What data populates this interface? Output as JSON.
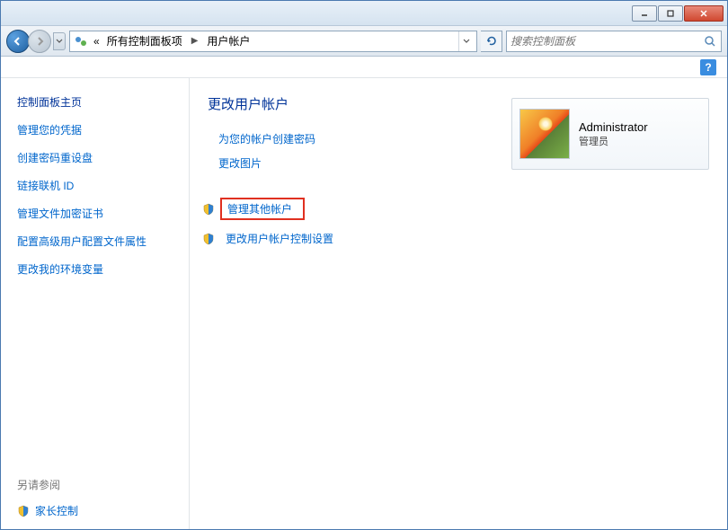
{
  "breadcrumb": {
    "prefix": "«",
    "seg1": "所有控制面板项",
    "seg2": "用户帐户"
  },
  "search": {
    "placeholder": "搜索控制面板"
  },
  "sidebar": {
    "title": "控制面板主页",
    "items": [
      "管理您的凭据",
      "创建密码重设盘",
      "链接联机 ID",
      "管理文件加密证书",
      "配置高级用户配置文件属性",
      "更改我的环境变量"
    ],
    "see_also": "另请参阅",
    "parental": "家长控制"
  },
  "main": {
    "title": "更改用户帐户",
    "links": {
      "create_password": "为您的帐户创建密码",
      "change_picture": "更改图片",
      "manage_other": "管理其他帐户",
      "uac_settings": "更改用户帐户控制设置"
    }
  },
  "user": {
    "name": "Administrator",
    "role": "管理员"
  },
  "help": "?"
}
